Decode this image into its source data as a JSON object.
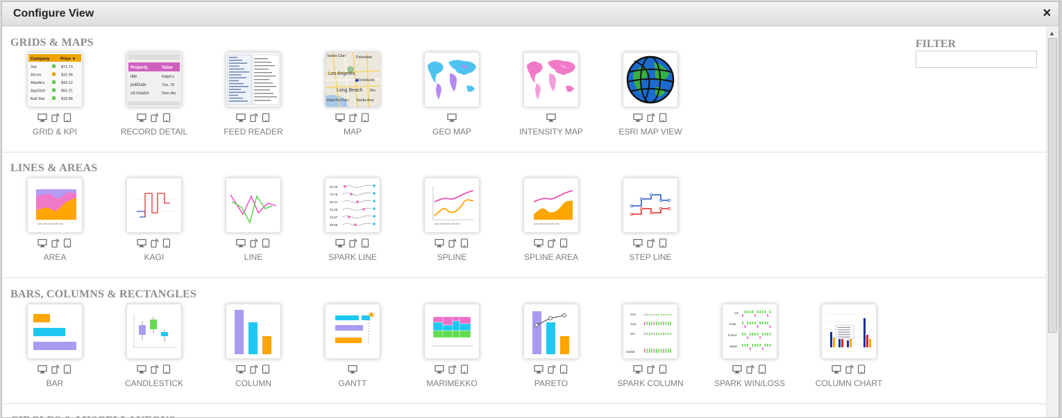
{
  "dialog": {
    "title": "Configure View",
    "close_glyph": "✕"
  },
  "filter": {
    "label": "FILTER",
    "value": "",
    "placeholder": ""
  },
  "sections": [
    {
      "title": "GRIDS & MAPS",
      "items": [
        {
          "label": "GRID & KPI",
          "icon": "grid-kpi-icon",
          "devices": [
            "desktop",
            "phone",
            "tablet"
          ]
        },
        {
          "label": "RECORD DETAIL",
          "icon": "record-detail-icon",
          "devices": [
            "desktop",
            "phone",
            "tablet"
          ]
        },
        {
          "label": "FEED READER",
          "icon": "feed-reader-icon",
          "devices": [
            "desktop",
            "phone",
            "tablet"
          ]
        },
        {
          "label": "MAP",
          "icon": "map-icon",
          "devices": [
            "desktop",
            "phone",
            "tablet"
          ]
        },
        {
          "label": "GEO MAP",
          "icon": "geo-map-icon",
          "devices": [
            "desktop"
          ]
        },
        {
          "label": "INTENSITY MAP",
          "icon": "intensity-map-icon",
          "devices": [
            "desktop"
          ]
        },
        {
          "label": "ESRI MAP VIEW",
          "icon": "esri-globe-icon",
          "devices": [
            "desktop",
            "phone",
            "tablet"
          ]
        }
      ]
    },
    {
      "title": "LINES & AREAS",
      "items": [
        {
          "label": "AREA",
          "icon": "area-chart-icon",
          "devices": [
            "desktop",
            "phone",
            "tablet"
          ]
        },
        {
          "label": "KAGI",
          "icon": "kagi-chart-icon",
          "devices": [
            "desktop",
            "phone",
            "tablet"
          ]
        },
        {
          "label": "LINE",
          "icon": "line-chart-icon",
          "devices": [
            "desktop",
            "phone",
            "tablet"
          ]
        },
        {
          "label": "SPARK LINE",
          "icon": "spark-line-icon",
          "devices": [
            "desktop",
            "phone",
            "tablet"
          ]
        },
        {
          "label": "SPLINE",
          "icon": "spline-chart-icon",
          "devices": [
            "desktop",
            "phone",
            "tablet"
          ]
        },
        {
          "label": "SPLINE AREA",
          "icon": "spline-area-icon",
          "devices": [
            "desktop",
            "phone",
            "tablet"
          ]
        },
        {
          "label": "STEP LINE",
          "icon": "step-line-icon",
          "devices": [
            "desktop",
            "phone",
            "tablet"
          ]
        }
      ]
    },
    {
      "title": "BARS, COLUMNS & RECTANGLES",
      "items": [
        {
          "label": "BAR",
          "icon": "bar-chart-icon",
          "devices": [
            "desktop",
            "phone",
            "tablet"
          ]
        },
        {
          "label": "CANDLESTICK",
          "icon": "candlestick-icon",
          "devices": [
            "desktop",
            "phone",
            "tablet"
          ]
        },
        {
          "label": "COLUMN",
          "icon": "column-chart-icon",
          "devices": [
            "desktop",
            "phone",
            "tablet"
          ]
        },
        {
          "label": "GANTT",
          "icon": "gantt-icon",
          "devices": [
            "desktop"
          ]
        },
        {
          "label": "MARIMEKKO",
          "icon": "marimekko-icon",
          "devices": [
            "desktop",
            "phone",
            "tablet"
          ]
        },
        {
          "label": "PARETO",
          "icon": "pareto-icon",
          "devices": [
            "desktop",
            "phone",
            "tablet"
          ]
        },
        {
          "label": "SPARK COLUMN",
          "icon": "spark-column-icon",
          "devices": [
            "desktop",
            "phone",
            "tablet"
          ]
        },
        {
          "label": "SPARK WIN/LOSS",
          "icon": "spark-win-loss-icon",
          "devices": [
            "desktop",
            "phone",
            "tablet"
          ]
        },
        {
          "label": "COLUMN CHART",
          "icon": "column-chart-alt-icon",
          "devices": [
            "desktop",
            "phone",
            "tablet"
          ]
        }
      ]
    },
    {
      "title": "CIRCLES & MISCELLANEOUS",
      "items": []
    }
  ],
  "thumb_text": {
    "grid": {
      "h1": "Company",
      "h2": "Price ▼",
      "rows": [
        [
          "3xp",
          "$71.73"
        ],
        [
          "Alcom",
          "$32.98"
        ],
        [
          "AltaMira",
          "$43.12"
        ],
        [
          "AppStart",
          "$56.21"
        ],
        [
          "Ball Star",
          "$18.88"
        ]
      ]
    },
    "record": {
      "h1": "Property",
      "h2": "Value",
      "rows": [
        [
          "title",
          "Ralph's"
        ],
        [
          "pubDate",
          "Tue, 15"
        ],
        [
          "cd:creator",
          "Dion Alo"
        ]
      ]
    },
    "map": [
      "Santa Clarita",
      "Palmdale",
      "Los Angeles",
      "Montebello",
      "Long Beach",
      "Rancho Palos Verdes",
      "Santa Ana",
      "Riv"
    ],
    "spark": [
      "23.45",
      "76.76",
      "30.41",
      "31.65",
      "33.57",
      "39.85"
    ],
    "spark_column": [
      "max",
      "mod",
      "min",
      "rainfall"
    ],
    "win_loss": [
      "US",
      "India",
      "France",
      "Japan"
    ]
  },
  "colors": {
    "orange": "#ffa500",
    "cyan": "#1ec8f0",
    "purple": "#a99bf0",
    "pink": "#f06ec8",
    "green": "#64dc50",
    "red": "#e03030"
  }
}
